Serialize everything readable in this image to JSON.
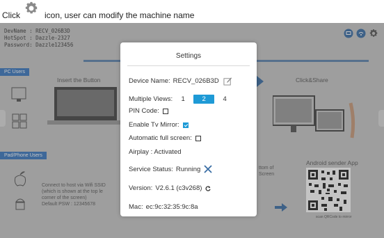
{
  "caption": {
    "before": "Click",
    "after": "icon, user can modify the machine name",
    "icon": "gear-icon"
  },
  "device_info": {
    "line1": "DevName : RECV_026B3D",
    "line2": "HotSpot : Dazzle-2327",
    "line3": "Password: Dazzle123456"
  },
  "tags": {
    "pc": "PC Users",
    "pad": "Pad/Phone Users"
  },
  "background": {
    "insert_button": "Insert the Button",
    "click_share": "Click&Share",
    "android_app": "Android sender App",
    "connect_line1": "Connect to host via Wifi SSID",
    "connect_line2": "(which is shown at the top le",
    "connect_line3": "corner of the screen)",
    "connect_line4": "Default PSW : 12345678",
    "bottom_of_line1": "ttom of",
    "bottom_of_line2": "Screen",
    "scan_qr": "scan QRCode to mirror"
  },
  "settings": {
    "title": "Settings",
    "device_name_label": "Device Name:",
    "device_name_value": "RECV_026B3D",
    "multiple_views_label": "Multiple Views:",
    "views": [
      "1",
      "2",
      "4"
    ],
    "selected_view": "2",
    "pin_code_label": "PIN Code:",
    "pin_code_checked": false,
    "tv_mirror_label": "Enable Tv Mirror:",
    "tv_mirror_checked": true,
    "auto_fullscreen_label": "Automatic full screen:",
    "auto_fullscreen_checked": false,
    "airplay_label": "Airplay : Activated",
    "service_status_label": "Service Status:",
    "service_status_value": "Running",
    "version_label": "Version:",
    "version_value": "V2.6.1 (c3v268)",
    "mac_label": "Mac:",
    "mac_value": "ec:9c:32:35:9c:8a"
  },
  "colors": {
    "accent": "#1e9ad6",
    "tag_blue": "#3a78c0"
  }
}
